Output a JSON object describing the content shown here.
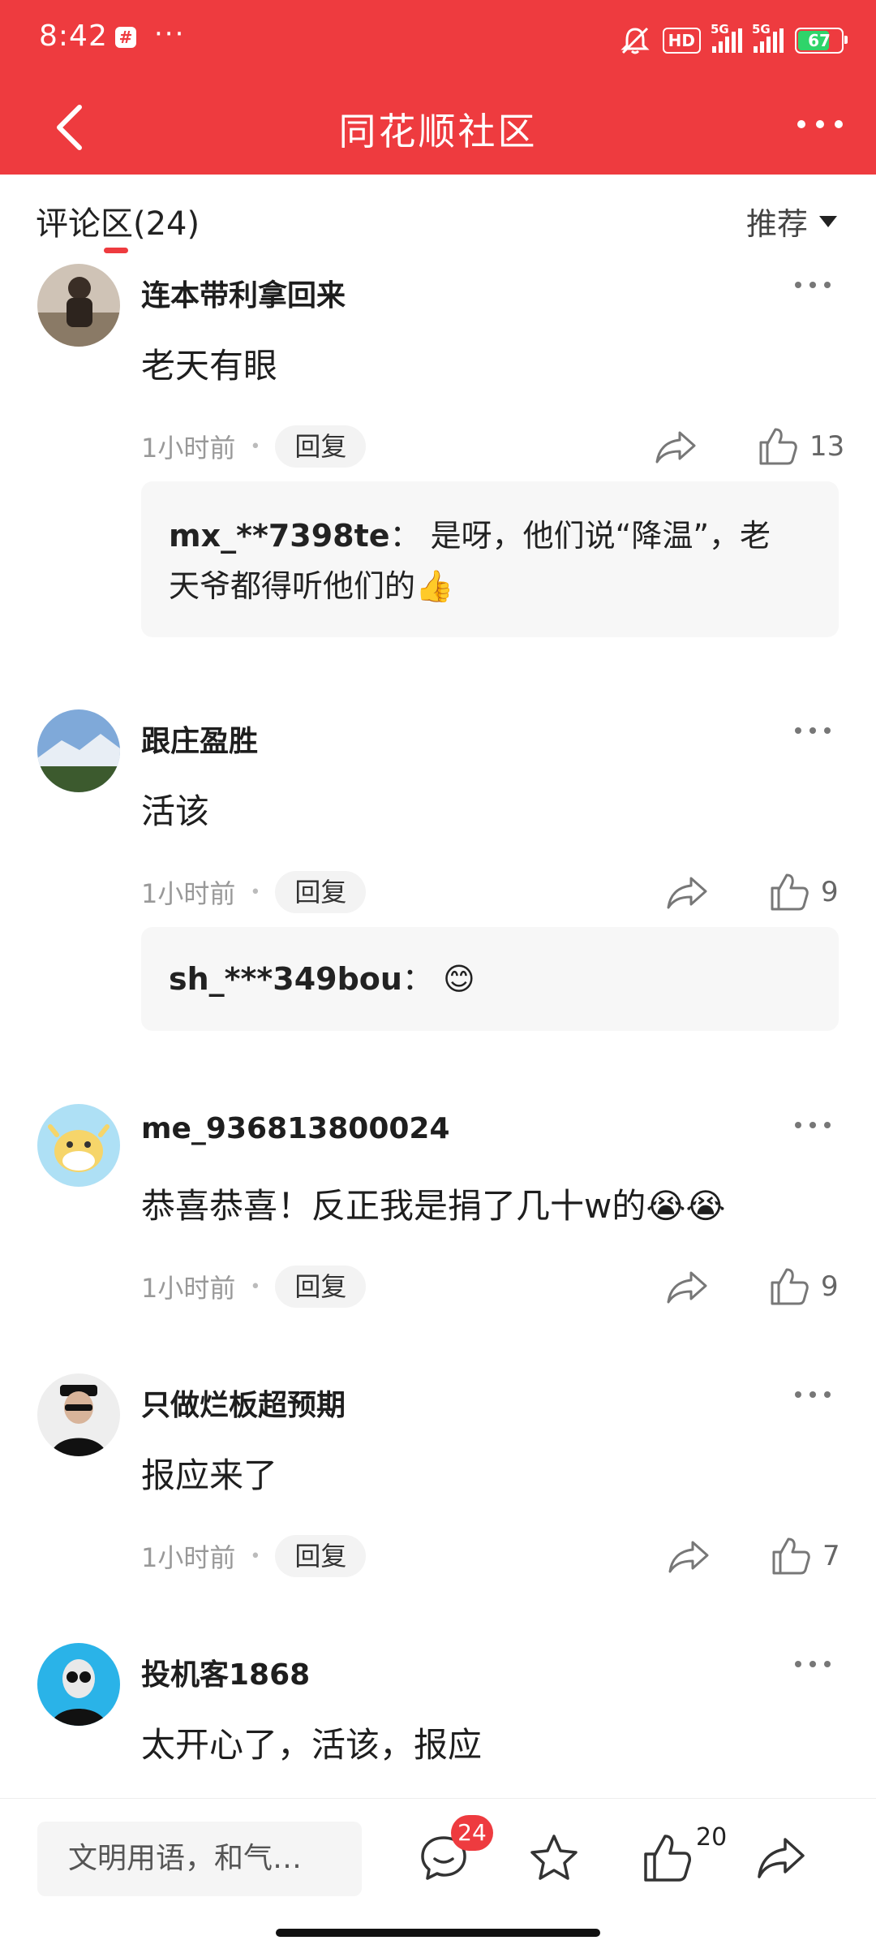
{
  "status_bar": {
    "time": "8:42",
    "notification_icon": "#",
    "overflow": "···",
    "hd_label": "HD",
    "sig1_label": "5G",
    "sig2_label": "5G",
    "battery": "67"
  },
  "nav": {
    "title": "同花顺社区"
  },
  "comments_header": {
    "title": "评论区(24)",
    "sort_label": "推荐"
  },
  "comments": [
    {
      "username": "连本带利拿回来",
      "text": "老天有眼",
      "time": "1小时前",
      "reply_label": "回复",
      "likes": "13",
      "sub_reply": {
        "user": "mx_**7398te",
        "sep": "：",
        "line1": "是呀，他们说“降温”，老",
        "line2": "天爷都得听他们的👍"
      }
    },
    {
      "username": "跟庄盈胜",
      "text": "活该",
      "time": "1小时前",
      "reply_label": "回复",
      "likes": "9",
      "sub_reply": {
        "user": "sh_***349bou",
        "sep": "：",
        "text": "😊"
      }
    },
    {
      "username": "me_936813800024",
      "text": "恭喜恭喜！反正我是捐了几十w的😭😭",
      "time": "1小时前",
      "reply_label": "回复",
      "likes": "9"
    },
    {
      "username": "只做烂板超预期",
      "text": "报应来了",
      "time": "1小时前",
      "reply_label": "回复",
      "likes": "7"
    },
    {
      "username": "投机客1868",
      "text": "太开心了，活该，报应"
    }
  ],
  "bottom_bar": {
    "input_placeholder": "文明用语，和气…",
    "comment_count": "24",
    "like_count": "20"
  },
  "colors": {
    "brand_red": "#ee3b3f",
    "battery_green": "#2fd46a"
  }
}
